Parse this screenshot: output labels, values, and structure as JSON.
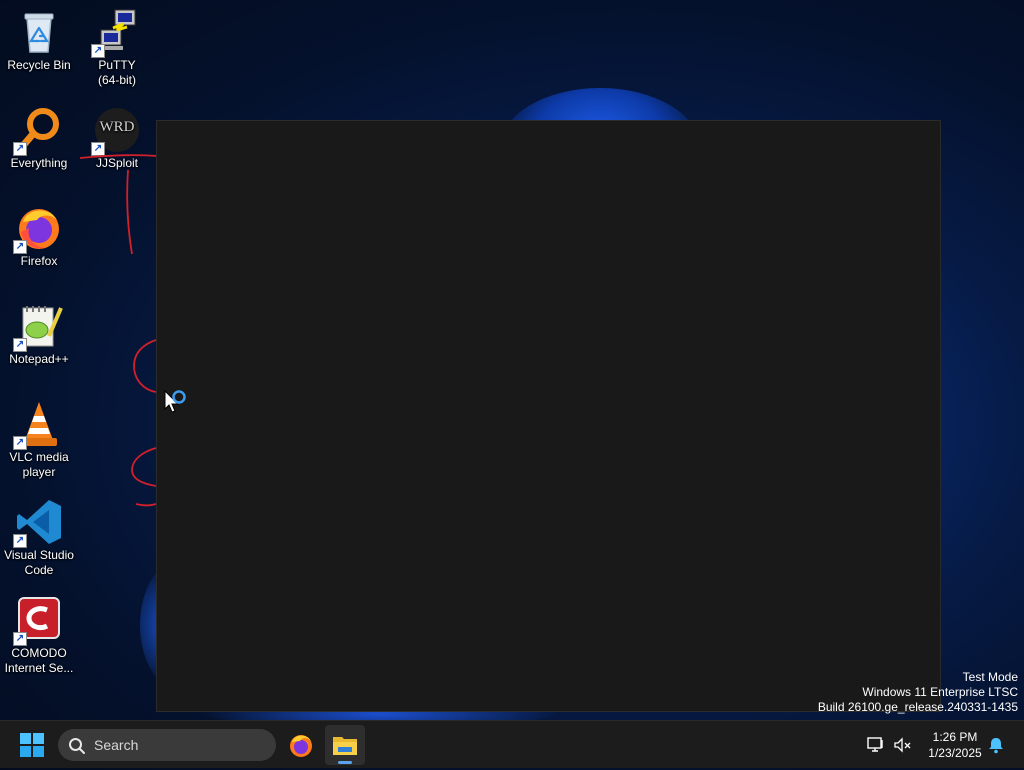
{
  "desktop": {
    "icons": [
      {
        "label": "Recycle Bin",
        "icon": "recycle-bin-icon"
      },
      {
        "label": "PuTTY\n(64-bit)",
        "icon": "putty-icon"
      },
      {
        "label": "Everything",
        "icon": "everything-icon"
      },
      {
        "label": "JJSploit",
        "icon": "jjsploit-icon",
        "badge": "WRD"
      },
      {
        "label": "Firefox",
        "icon": "firefox-icon"
      },
      {
        "label": "Notepad++",
        "icon": "notepad-plus-plus-icon"
      },
      {
        "label": "VLC media\nplayer",
        "icon": "vlc-icon"
      },
      {
        "label": "Visual Studio\nCode",
        "icon": "vscode-icon"
      },
      {
        "label": "COMODO\nInternet Se...",
        "icon": "comodo-icon"
      }
    ]
  },
  "watermark": {
    "line1": "Test Mode",
    "line2": "Windows 11 Enterprise LTSC",
    "line3": "Build 26100.ge_release.240331-1435"
  },
  "taskbar": {
    "search_placeholder": "Search",
    "apps": [
      {
        "name": "Firefox",
        "icon": "firefox-icon",
        "active": false
      },
      {
        "name": "File Explorer",
        "icon": "file-explorer-icon",
        "active": true
      }
    ],
    "tray": {
      "time": "1:26 PM",
      "date": "1/23/2025"
    }
  },
  "colors": {
    "taskbar_bg": "#1c1c1c",
    "window_bg": "#191919",
    "accent": "#5ba3ea",
    "annotation_red": "#d0202a"
  }
}
